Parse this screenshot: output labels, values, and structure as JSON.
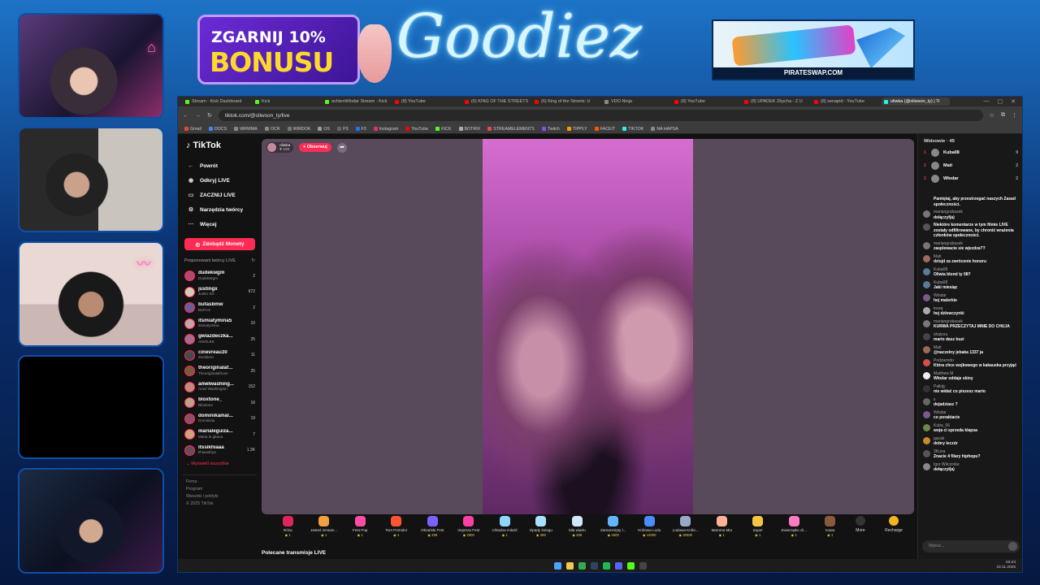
{
  "overlay": {
    "promo_line1": "ZGARNIJ 10%",
    "promo_line2": "BONUSU",
    "brand": "Goodiez",
    "ad_caption": "PIRATESWAP.COM",
    "colors": {
      "accent": "#fe2c55",
      "overlay_blue": "#1d73c7",
      "promo_purple": "#6b2bd6"
    }
  },
  "browser": {
    "tabs": [
      {
        "label": "Stream - Kick Dashboard",
        "color": "#53fc18"
      },
      {
        "label": "Kick",
        "color": "#53fc18"
      },
      {
        "label": "achtenWlodar Stream - Kick",
        "color": "#53fc18"
      },
      {
        "label": "(8) YouTube",
        "color": "#ff0000"
      },
      {
        "label": "(6) KING OF THE STREETS",
        "color": "#ff0000"
      },
      {
        "label": "(6) King of the Streets: U",
        "color": "#ff0000"
      },
      {
        "label": "VDO.Ninja",
        "color": "#888888"
      },
      {
        "label": "(8) YouTube",
        "color": "#ff0000"
      },
      {
        "label": "(8) UPADEK Zbycha - Z U",
        "color": "#ff0000"
      },
      {
        "label": "(8) senapid - YouTube",
        "color": "#ff0000"
      },
      {
        "label": "oliwka (@oliwson_ty) | Ti",
        "color": "#25f4ee"
      }
    ],
    "url": "tiktok.com/@oliwson_ty/live",
    "bookmarks": [
      "Gmail",
      "DOCS",
      "WRWMA",
      "OCR",
      "WIRDOK",
      "OS",
      "P3",
      "F3",
      "Instagram",
      "YouTube",
      "KICK",
      "BOTRIX",
      "STREAMELEMENTS",
      "Twitch",
      "TIPPLY",
      "FACEIT",
      "TIKTOK",
      "NA HAPSA"
    ]
  },
  "tiktok": {
    "logo": "TikTok",
    "nav": [
      {
        "icon": "←",
        "label": "Powrót"
      },
      {
        "icon": "◉",
        "label": "Odkryj LIVE"
      },
      {
        "icon": "▭",
        "label": "ZACZNIJ LIVE"
      },
      {
        "icon": "⚙",
        "label": "Narzędzia twórcy"
      },
      {
        "icon": "···",
        "label": "Więcej"
      }
    ],
    "coins_button": "Zdobądź Monety",
    "recommended_header": "Proponowani twórcy LIVE",
    "creators": [
      {
        "name": "dudekwgm",
        "sub": "DudekWgm",
        "count": "2",
        "color": "#b24a6f"
      },
      {
        "name": "justingx",
        "sub": "Justin XD",
        "count": "672",
        "color": "#d9c9b7"
      },
      {
        "name": "bufasbmw",
        "sub": "BUFAS",
        "count": "2",
        "color": "#6e5a9c"
      },
      {
        "name": "itsmiatymina5",
        "sub": "itsmiatymina",
        "count": "10",
        "color": "#caa3a8"
      },
      {
        "name": "gwiazdeczka...",
        "sub": "ANIOLEK",
        "count": "25",
        "color": "#a86b8d"
      },
      {
        "name": "cinevreau30",
        "sub": "Zocktiere",
        "count": "11",
        "color": "#4a4a4a"
      },
      {
        "name": "theoriginalaf...",
        "sub": "Theoriginalafrican",
        "count": "25",
        "color": "#7a5a3c"
      },
      {
        "name": "amelwashing...",
        "sub": "Amel Washington",
        "count": "152",
        "color": "#c58a7a"
      },
      {
        "name": "bloxtone_",
        "sub": "Bloxtone",
        "count": "16",
        "color": "#bfa08c"
      },
      {
        "name": "dominikamal...",
        "sub": "Dominisia",
        "count": "19",
        "color": "#8e4e66"
      },
      {
        "name": "marialeguiza...",
        "sub": "Maria la gitana",
        "count": "7",
        "color": "#d1a27d"
      },
      {
        "name": "itssikhiaaa",
        "sub": "khiaawhya",
        "count": "1.3K",
        "color": "#6b4a5a"
      }
    ],
    "show_all": "Wyświetl wszystkie",
    "footer": [
      "Firma",
      "Program",
      "Warunki i polityki",
      "© 2025 TikTok"
    ],
    "host": {
      "name": "oliwka",
      "likes": "♥ 120"
    },
    "follow_label": "+ Obserwuj",
    "gifts": [
      {
        "name": "Róża",
        "price": "1",
        "color": "#e0245e"
      },
      {
        "name": "Jesteś niesam...",
        "price": "1",
        "color": "#f0a040"
      },
      {
        "name": "Fest Pop",
        "price": "1",
        "color": "#ff4da6"
      },
      {
        "name": "Tom Pomidor",
        "price": "1",
        "color": "#ff5533"
      },
      {
        "name": "Okrański Fest",
        "price": "299",
        "color": "#7b61ff"
      },
      {
        "name": "Impreza Fest",
        "price": "2000",
        "color": "#ff3fa4"
      },
      {
        "name": "Chłodna miłość",
        "price": "1",
        "color": "#8fd6ff"
      },
      {
        "name": "Opady śniegu",
        "price": "399",
        "color": "#a8e0ff"
      },
      {
        "name": "Siła wiatru",
        "price": "299",
        "color": "#d0e8ff"
      },
      {
        "name": "Zamarznięty l...",
        "price": "2500",
        "color": "#5fb6ff"
      },
      {
        "name": "Królowa Lodu",
        "price": "12000",
        "color": "#4a8cff"
      },
      {
        "name": "Lodowa Króle...",
        "price": "20000",
        "color": "#9aa8c8"
      },
      {
        "name": "Mamma Mia",
        "price": "1",
        "color": "#ffb199"
      },
      {
        "name": "Super",
        "price": "1",
        "color": "#f5c542"
      },
      {
        "name": "Zwierzątko cli...",
        "price": "1",
        "color": "#ff7ac1"
      },
      {
        "name": "Kawa",
        "price": "1",
        "color": "#8a5a3c"
      }
    ],
    "more_label": "More",
    "recharge_label": "Recharge",
    "recommended_streams": "Polecane transmisje LIVE",
    "viewers_header": "Widzowie · 45",
    "top_viewers": [
      {
        "rank": "1",
        "name": "Kuba08",
        "count": "9"
      },
      {
        "rank": "2",
        "name": "Mati",
        "count": "2"
      },
      {
        "rank": "3",
        "name": "Włodar",
        "count": "2"
      }
    ],
    "chat": [
      {
        "user": "",
        "text": "Pamiętaj, aby przestrzegać naszych Zasad społeczności.",
        "color": "#181818"
      },
      {
        "user": "mariangrubasek",
        "text": "dołączył(a)",
        "color": "#777"
      },
      {
        "user": "",
        "text": "Niektóre komentarze w tym filmie LIVE zostały odfiltrowane, by chronić wrażenia członków społeczności.",
        "color": "#555"
      },
      {
        "user": "mariangrubasek",
        "text": "zasplewacie sie wjezdza??",
        "color": "#777"
      },
      {
        "user": "Mati",
        "text": "dzisjd za zwrócenie honoru",
        "color": "#9a6a5a"
      },
      {
        "user": "Kuba08",
        "text": "Oliwia blond ty 08?",
        "color": "#5a7a9a"
      },
      {
        "user": "Kuba08",
        "text": "Jaki miesiąc",
        "color": "#5a7a9a"
      },
      {
        "user": "Włodar",
        "text": "hej malerkie",
        "color": "#7a5a8a"
      },
      {
        "user": "treeq",
        "text": "hej dzlewczynki",
        "color": "#aaa"
      },
      {
        "user": "mariangrubasek",
        "text": "KURWA PRZECZYTAJ MNIE DO CHUJA",
        "color": "#777"
      },
      {
        "user": "shalzou",
        "text": "mario dasz buzi",
        "color": "#444"
      },
      {
        "user": "Mati",
        "text": "@naczelny jebaka 1337 ja",
        "color": "#9a6a5a"
      },
      {
        "user": "Podziemito",
        "text": "Która chce wojkowego w kakauska przyjąć",
        "color": "#d05050"
      },
      {
        "user": "Matthew M",
        "text": "Włodar oddaje skiny",
        "color": "#eee"
      },
      {
        "user": "Pałkijy",
        "text": "nie widać co piszesz mario",
        "color": "#333"
      },
      {
        "user": "s",
        "text": "dojadziasz ?",
        "color": "#666"
      },
      {
        "user": "Włodar",
        "text": "co porabiacie",
        "color": "#7a5a8a"
      },
      {
        "user": "Kuba_06",
        "text": "woja ci sprzeda klapsa",
        "color": "#6a8a4a"
      },
      {
        "user": "gacak",
        "text": "dobry leczór",
        "color": "#c88a2a"
      },
      {
        "user": "3Kuna",
        "text": "Znacie 4 filary hiphopu?",
        "color": "#555"
      },
      {
        "user": "Igor Wilczorke",
        "text": "dołączył(a)",
        "color": "#888"
      }
    ],
    "chat_placeholder": "Wpisz..."
  },
  "taskbar": {
    "icons": [
      {
        "name": "windows",
        "color": "#4aa3ff"
      },
      {
        "name": "explorer",
        "color": "#f2c94c"
      },
      {
        "name": "chrome",
        "color": "#34a853"
      },
      {
        "name": "steam",
        "color": "#2a475e"
      },
      {
        "name": "spotify",
        "color": "#1db954"
      },
      {
        "name": "discord",
        "color": "#5865f2"
      },
      {
        "name": "kick",
        "color": "#53fc18"
      },
      {
        "name": "obs",
        "color": "#444"
      }
    ],
    "time": "03:23",
    "date": "23.11.2025"
  }
}
